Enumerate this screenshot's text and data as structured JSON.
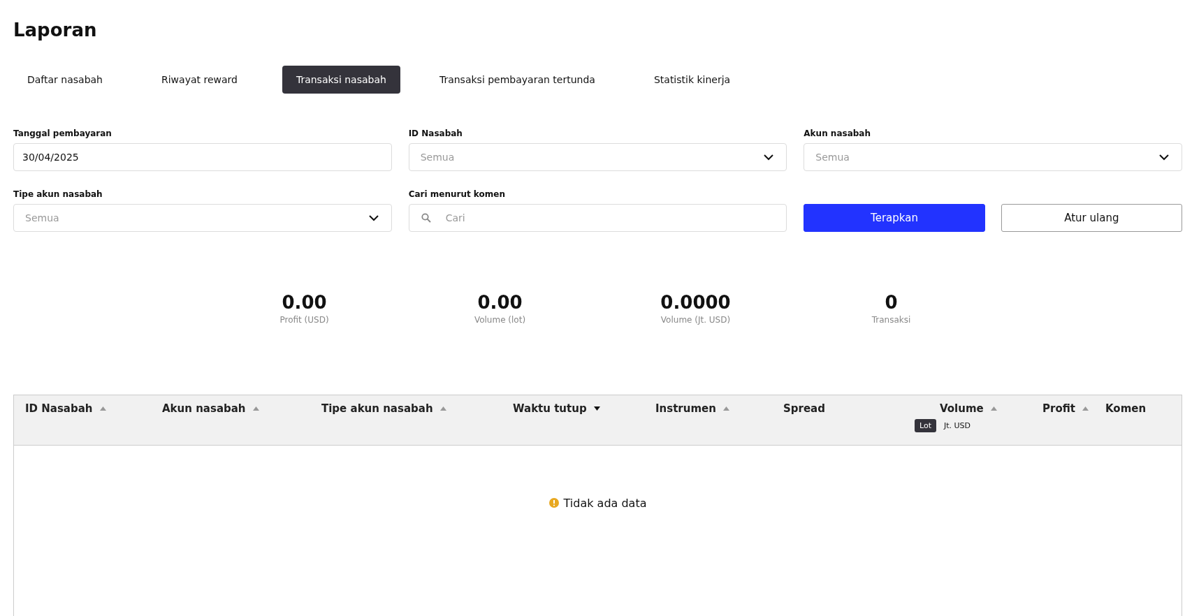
{
  "page": {
    "title": "Laporan"
  },
  "tabs": [
    {
      "label": "Daftar nasabah",
      "selected": false
    },
    {
      "label": "Riwayat reward",
      "selected": false
    },
    {
      "label": "Transaksi nasabah",
      "selected": true
    },
    {
      "label": "Transaksi pembayaran tertunda",
      "selected": false
    },
    {
      "label": "Statistik kinerja",
      "selected": false
    }
  ],
  "filters": [
    {
      "kind": "text",
      "label": "Tanggal pembayaran",
      "value": "30/04/2025"
    },
    {
      "kind": "select",
      "label": "ID Nasabah",
      "placeholder": "Semua"
    },
    {
      "kind": "select",
      "label": "Akun nasabah",
      "placeholder": "Semua"
    },
    {
      "kind": "select",
      "label": "Tipe akun nasabah",
      "placeholder": "Semua"
    },
    {
      "kind": "search",
      "label": "Cari menurut komen",
      "placeholder": "Cari"
    }
  ],
  "buttons": [
    {
      "kind": "primary",
      "label": "Terapkan"
    },
    {
      "kind": "secondary",
      "label": "Atur ulang"
    }
  ],
  "stats": [
    {
      "value": "0.00",
      "label": "Profit (USD)"
    },
    {
      "value": "0.00",
      "label": "Volume (lot)"
    },
    {
      "value": "0.0000",
      "label": "Volume (Jt. USD)"
    },
    {
      "value": "0",
      "label": "Transaksi"
    }
  ],
  "table": {
    "columns": [
      {
        "label": "ID Nasabah",
        "sorted": false
      },
      {
        "label": "Akun nasabah",
        "sorted": false
      },
      {
        "label": "Tipe akun nasabah",
        "sorted": false
      },
      {
        "label": "Waktu tutup",
        "sorted": true
      },
      {
        "label": "Instrumen",
        "sorted": false
      },
      {
        "label": "Spread"
      },
      {
        "label": "Volume",
        "sorted": false,
        "units": [
          {
            "label": "Lot",
            "selected": true
          },
          {
            "label": "Jt. USD",
            "selected": false
          }
        ]
      },
      {
        "label": "Profit",
        "sorted": false
      },
      {
        "label": "Komen"
      }
    ],
    "empty_message": "Tidak ada data"
  }
}
